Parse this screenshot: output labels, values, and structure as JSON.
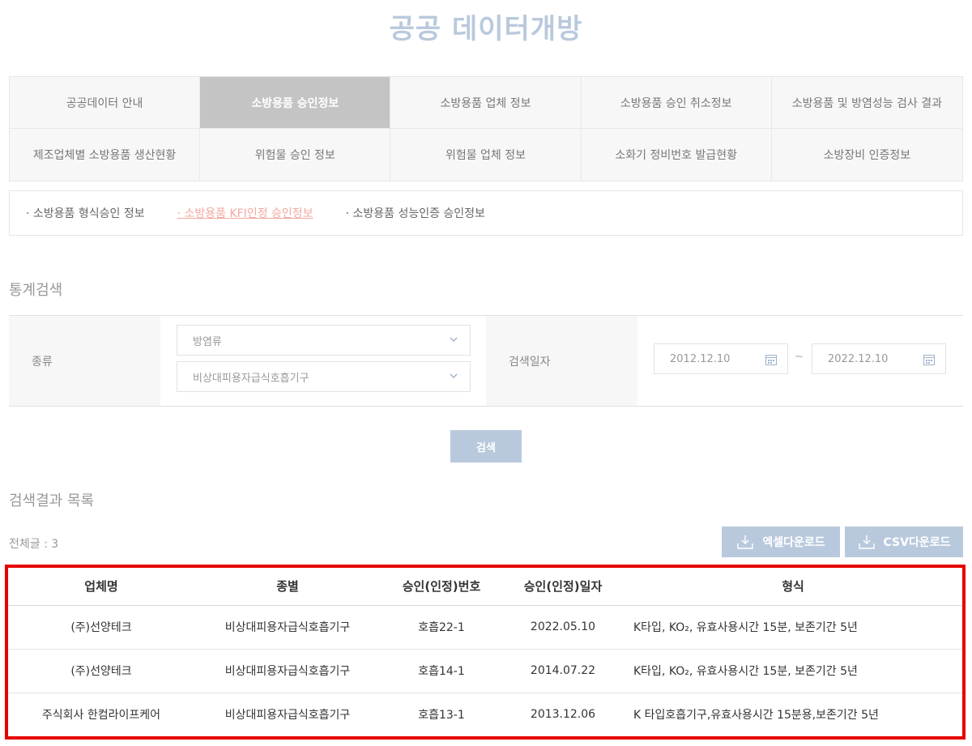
{
  "page": {
    "title": "공공 데이터개방"
  },
  "menu": [
    {
      "label": "공공데이터 안내",
      "active": false
    },
    {
      "label": "소방용품 승인정보",
      "active": true
    },
    {
      "label": "소방용품 업체 정보",
      "active": false
    },
    {
      "label": "소방용품 승인 취소정보",
      "active": false
    },
    {
      "label": "소방용품 및 방염성능 검사 결과",
      "active": false
    },
    {
      "label": "제조업체별 소방용품 생산현황",
      "active": false
    },
    {
      "label": "위험물 승인 정보",
      "active": false
    },
    {
      "label": "위험물 업체 정보",
      "active": false
    },
    {
      "label": "소화기 정비번호 발급현황",
      "active": false
    },
    {
      "label": "소방장비 인증정보",
      "active": false
    }
  ],
  "subtabs": [
    {
      "label": "· 소방용품 형식승인 정보",
      "active": false
    },
    {
      "label": "· 소방용품 KFI인정 승인정보",
      "active": true
    },
    {
      "label": "· 소방용품 성능인증 승인정보",
      "active": false
    }
  ],
  "search": {
    "section_title": "통계검색",
    "kind_label": "종류",
    "select1": "방염류",
    "select2": "비상대피용자급식호흡기구",
    "date_label": "검색일자",
    "date_from": "2012.12.10",
    "date_to": "2022.12.10",
    "tilde": "~",
    "button": "검색"
  },
  "results": {
    "section_title": "검색결과 목록",
    "total": "전체글 : 3",
    "excel_button": "엑셀다운로드",
    "csv_button": "CSV다운로드",
    "columns": [
      "업체명",
      "종별",
      "승인(인정)번호",
      "승인(인정)일자",
      "형식"
    ],
    "rows": [
      [
        "(주)선양테크",
        "비상대피용자급식호흡기구",
        "호흡22-1",
        "2022.05.10",
        "K타입, KO₂, 유효사용시간 15분, 보존기간 5년"
      ],
      [
        "(주)선양테크",
        "비상대피용자급식호흡기구",
        "호흡14-1",
        "2014.07.22",
        "K타입, KO₂, 유효사용시간 15분, 보존기간 5년"
      ],
      [
        "주식회사 한컴라이프케어",
        "비상대피용자급식호흡기구",
        "호흡13-1",
        "2013.12.06",
        "K 타입호흡기구,유효사용시간 15분용,보존기간 5년"
      ]
    ]
  },
  "colors": {
    "accent": "#b9c9dd",
    "active_menu": "#c4c4c4",
    "active_subtab": "#f2a9a0",
    "highlight_border": "#e60000"
  }
}
